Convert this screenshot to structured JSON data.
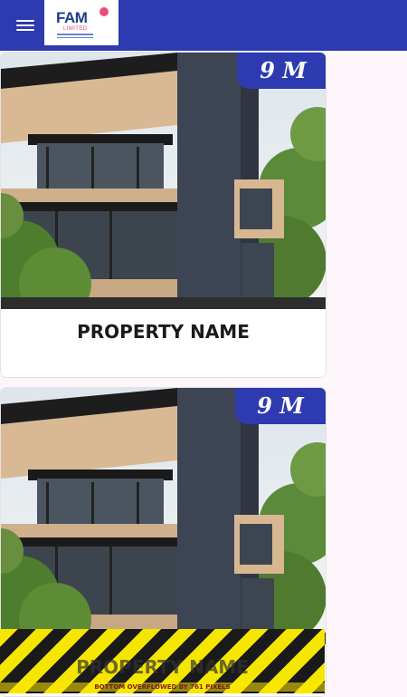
{
  "appbar": {
    "menu_icon": "hamburger-menu-icon",
    "logo": {
      "brand": "FAM",
      "subtitle": "LIMITED"
    },
    "color": "#2d3ab0"
  },
  "listings": [
    {
      "price": "9 M",
      "name": "PROPERTY NAME",
      "image": "modern-house-photo"
    },
    {
      "price": "9 M",
      "name": "PROPERTY NAME",
      "image": "modern-house-photo"
    }
  ],
  "overflow_warning": "BOTTOM OVERFLOWED BY 761 PIXELS"
}
